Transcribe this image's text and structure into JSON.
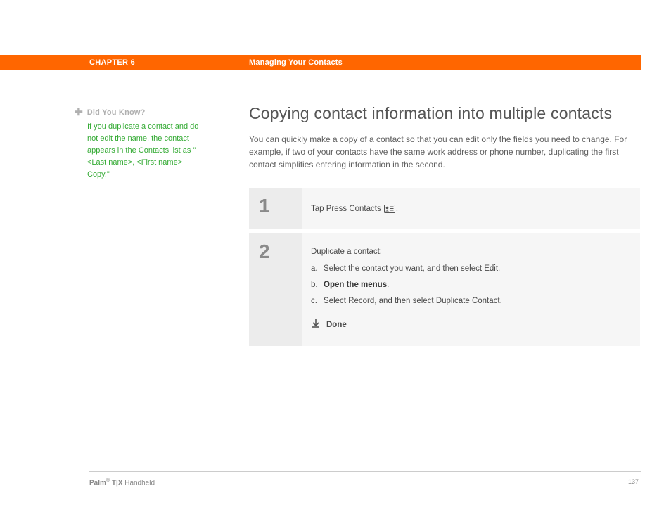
{
  "header": {
    "chapter_label": "CHAPTER 6",
    "chapter_title": "Managing Your Contacts"
  },
  "sidebar": {
    "did_you_know_label": "Did You Know?",
    "did_you_know_body": "If you duplicate a contact and do not edit the name, the contact appears in the Contacts list as \"<Last name>, <First name> Copy.\""
  },
  "main": {
    "title": "Copying contact information into multiple contacts",
    "intro": "You can quickly make a copy of a contact so that you can edit only the fields you need to change. For example, if two of your contacts have the same work address or phone number, duplicating the first contact simplifies entering information in the second."
  },
  "steps": {
    "s1": {
      "num": "1",
      "text_before": "Tap Press Contacts ",
      "text_after": "."
    },
    "s2": {
      "num": "2",
      "lead": "Duplicate a contact:",
      "a_letter": "a.",
      "a_text": "Select the contact you want, and then select Edit.",
      "b_letter": "b.",
      "b_text": "Open the menus",
      "b_suffix": ".",
      "c_letter": "c.",
      "c_text": "Select Record, and then select Duplicate Contact.",
      "done": "Done"
    }
  },
  "footer": {
    "brand_bold": "Palm",
    "reg": "®",
    "model": " T|X",
    "suffix": " Handheld",
    "page": "137"
  }
}
